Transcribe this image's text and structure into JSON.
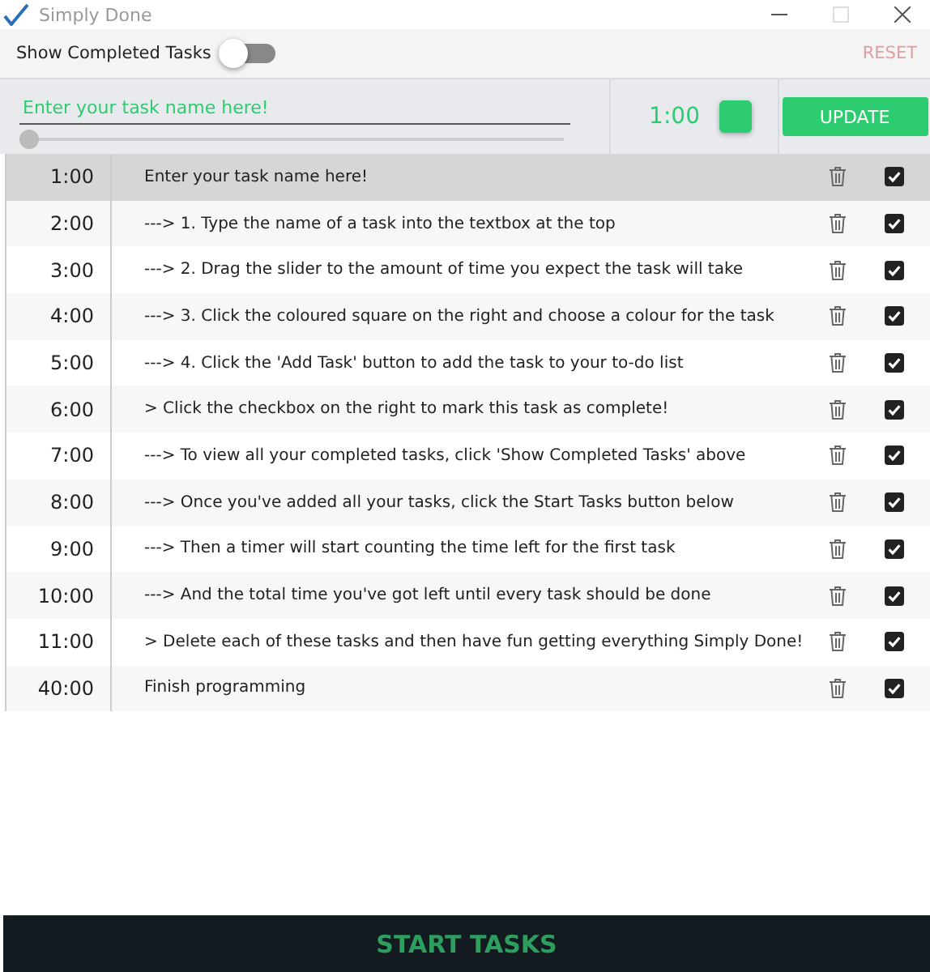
{
  "window": {
    "title": "Simply Done"
  },
  "toolbar": {
    "toggle_label": "Show Completed Tasks",
    "show_completed": {
      "on": false
    },
    "reset": "RESET"
  },
  "entry": {
    "placeholder": "Enter your task name here!",
    "duration": {
      "level": 0
    },
    "time": "1:00",
    "color": "#2ecc71",
    "update": "UPDATE"
  },
  "tasks": [
    {
      "time": "1:00",
      "name": "Enter your task name here!",
      "selected": true,
      "checked": true
    },
    {
      "time": "2:00",
      "name": "---> 1. Type the name of a task into the textbox at the top",
      "selected": false,
      "checked": true
    },
    {
      "time": "3:00",
      "name": "---> 2. Drag the slider to the amount of time you expect the task will take",
      "selected": false,
      "checked": true
    },
    {
      "time": "4:00",
      "name": "---> 3. Click the coloured square on the right and choose a colour for the task",
      "selected": false,
      "checked": true
    },
    {
      "time": "5:00",
      "name": "---> 4. Click the 'Add Task' button to add the task to your to-do list",
      "selected": false,
      "checked": true
    },
    {
      "time": "6:00",
      "name": "> Click the checkbox on the right to mark this task as complete!",
      "selected": false,
      "checked": true
    },
    {
      "time": "7:00",
      "name": "---> To view all your completed tasks, click 'Show Completed Tasks' above",
      "selected": false,
      "checked": true
    },
    {
      "time": "8:00",
      "name": "---> Once you've added all your tasks, click the Start Tasks button below",
      "selected": false,
      "checked": true
    },
    {
      "time": "9:00",
      "name": "---> Then a timer will start counting the time left for the first task",
      "selected": false,
      "checked": true
    },
    {
      "time": "10:00",
      "name": "---> And the total time you've got left until every task should be done",
      "selected": false,
      "checked": true
    },
    {
      "time": "11:00",
      "name": "> Delete each of these tasks and then have fun getting everything Simply Done!",
      "selected": false,
      "checked": true
    },
    {
      "time": "40:00",
      "name": "Finish programming",
      "selected": false,
      "checked": true
    }
  ],
  "start_button": "START TASKS"
}
